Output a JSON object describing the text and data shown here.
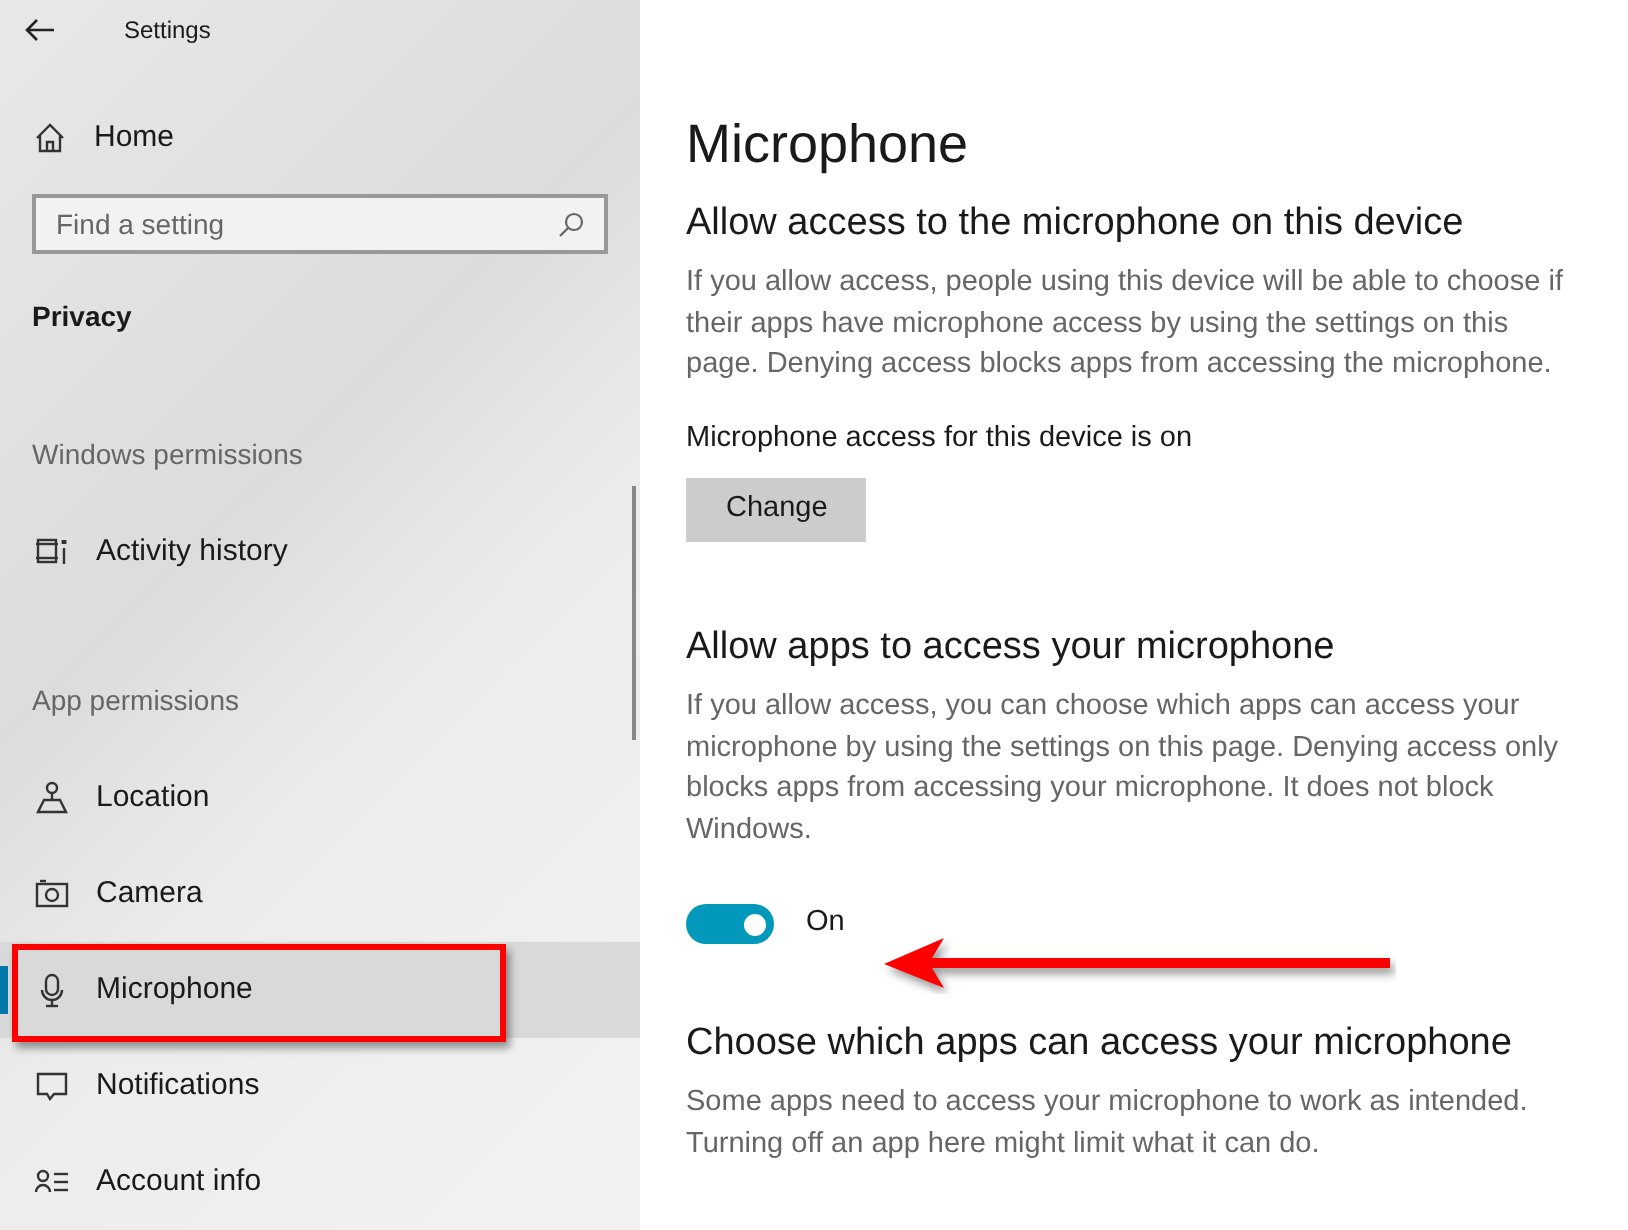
{
  "window": {
    "title": "Settings"
  },
  "sidebar": {
    "home": "Home",
    "search": {
      "placeholder": "Find a setting"
    },
    "section": "Privacy",
    "groups": [
      {
        "heading": "Windows permissions",
        "items": [
          {
            "label": "Activity history",
            "selected": false
          }
        ]
      },
      {
        "heading": "App permissions",
        "items": [
          {
            "label": "Location",
            "selected": false
          },
          {
            "label": "Camera",
            "selected": false
          },
          {
            "label": "Microphone",
            "selected": true
          },
          {
            "label": "Notifications",
            "selected": false
          },
          {
            "label": "Account info",
            "selected": false
          }
        ]
      }
    ]
  },
  "page": {
    "title": "Microphone",
    "sections": [
      {
        "heading": "Allow access to the microphone on this device",
        "body": "If you allow access, people using this device will be able to choose if their apps have microphone access by using the settings on this page. Denying access blocks apps from accessing the microphone.",
        "status": "Microphone access for this device is on",
        "button": "Change"
      },
      {
        "heading": "Allow apps to access your microphone",
        "body": "If you allow access, you can choose which apps can access your microphone by using the settings on this page. Denying access only blocks apps from accessing your microphone. It does not block Windows.",
        "toggle": {
          "on": true,
          "label": "On"
        }
      },
      {
        "heading": "Choose which apps can access your microphone",
        "body": "Some apps need to access your microphone to work as intended. Turning off an app here might limit what it can do."
      }
    ]
  },
  "annotations": {
    "highlight_box": true,
    "pointer_arrow": true
  }
}
